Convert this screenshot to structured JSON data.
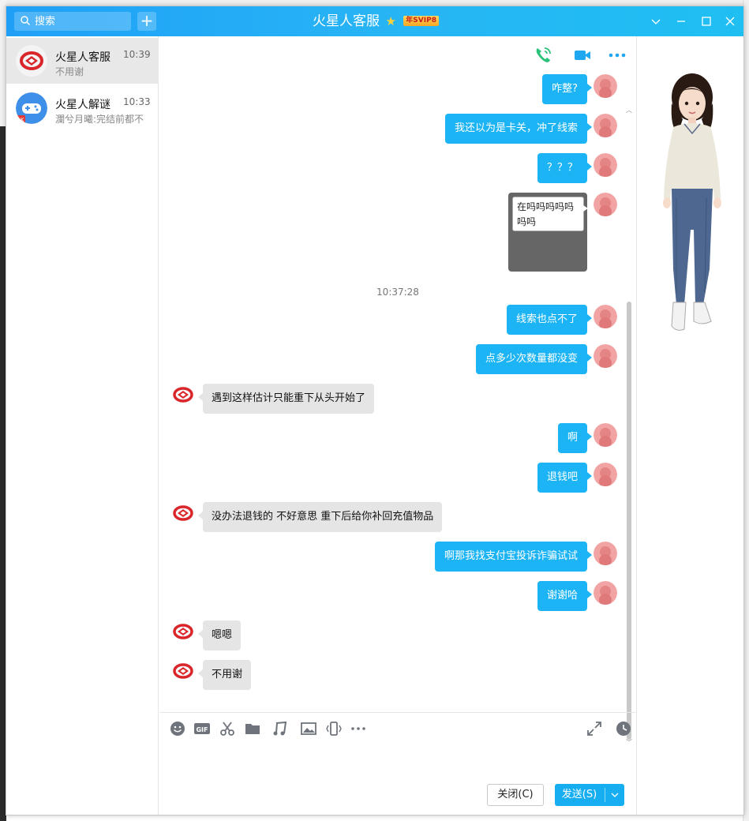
{
  "window": {
    "title": "火星人客服",
    "vip_badge": "年SVIP8"
  },
  "search": {
    "placeholder": "搜索"
  },
  "add_button_label": "+",
  "contacts": [
    {
      "name": "火星人客服",
      "time": "10:39",
      "preview": "不用谢",
      "avatar": "mars-logo-icon",
      "active": true
    },
    {
      "name": "火星人解谜",
      "time": "10:33",
      "preview": "瀾兮月曦:完结前都不",
      "avatar": "gamepad-icon",
      "badge": "1K",
      "active": false
    }
  ],
  "toolbar_icons": [
    "phone-icon",
    "video-call-icon",
    "more-icon"
  ],
  "messages": [
    {
      "dir": "out",
      "text": "咋整?"
    },
    {
      "dir": "out",
      "text": "我还以为是卡关，冲了线索"
    },
    {
      "dir": "out",
      "text": "？？？"
    },
    {
      "dir": "out",
      "type": "image",
      "text": "在吗吗吗吗吗吗吗"
    },
    {
      "type": "time",
      "text": "10:37:28"
    },
    {
      "dir": "out",
      "text": "线索也点不了"
    },
    {
      "dir": "out",
      "text": "点多少次数量都没变"
    },
    {
      "dir": "in",
      "text": "遇到这样估计只能重下从头开始了"
    },
    {
      "dir": "out",
      "text": "啊"
    },
    {
      "dir": "out",
      "text": "退钱吧"
    },
    {
      "dir": "in",
      "text": "没办法退钱的  不好意思  重下后给你补回充值物品"
    },
    {
      "dir": "out",
      "text": "啊那我找支付宝投诉诈骗试试"
    },
    {
      "dir": "out",
      "text": "谢谢哈"
    },
    {
      "dir": "in",
      "text": "嗯嗯"
    },
    {
      "dir": "in",
      "text": "不用谢"
    }
  ],
  "input_tools": [
    "emoji-icon",
    "gif-icon",
    "scissors-icon",
    "folder-icon",
    "music-icon",
    "image-icon",
    "shake-icon",
    "more-icon",
    "expand-icon",
    "history-icon"
  ],
  "buttons": {
    "close": "关闭(C)",
    "send": "发送(S)"
  },
  "colors": {
    "title_bar": "#1fb0f5",
    "outgoing_bubble": "#1db4f5",
    "incoming_bubble": "#e5e5e5",
    "send_button": "#16aef0"
  }
}
